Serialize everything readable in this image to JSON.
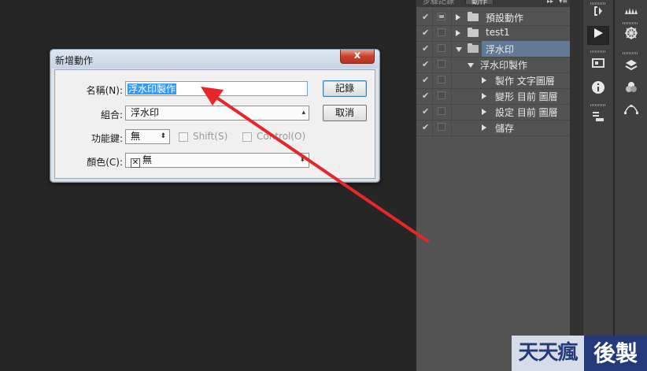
{
  "panel": {
    "tabs": [
      "步驟記錄",
      "動作"
    ],
    "rows": [
      {
        "label": "預設動作",
        "kind": "set",
        "expanded": false,
        "dialog": true
      },
      {
        "label": "test1",
        "kind": "set",
        "expanded": false,
        "dialog": false
      },
      {
        "label": "浮水印",
        "kind": "set",
        "expanded": true,
        "dialog": false,
        "selected": true
      },
      {
        "label": "浮水印製作",
        "kind": "action",
        "expanded": true,
        "dialog": false
      },
      {
        "label": "製作 文字圖層",
        "kind": "step",
        "dialog": false
      },
      {
        "label": "變形 目前 圖層",
        "kind": "step",
        "dialog": false
      },
      {
        "label": "設定 目前 圖層",
        "kind": "step",
        "dialog": false
      },
      {
        "label": "儲存",
        "kind": "step",
        "dialog": false
      }
    ]
  },
  "dialog": {
    "title": "新增動作",
    "close_label": "x",
    "name_label": "名稱(N):",
    "name_value": "浮水印製作",
    "set_label": "組合:",
    "set_value": "浮水印",
    "fkey_label": "功能鍵:",
    "fkey_value": "無",
    "shift_label": "Shift(S)",
    "control_label": "Control(O)",
    "color_label": "顏色(C):",
    "color_value": "無",
    "record_button": "記錄",
    "cancel_button": "取消"
  },
  "watermark": {
    "left": "天天瘋",
    "right": "後製"
  },
  "colors": {
    "arrow": "#e8262a",
    "selection": "#627a95",
    "workspace": "#262626"
  }
}
